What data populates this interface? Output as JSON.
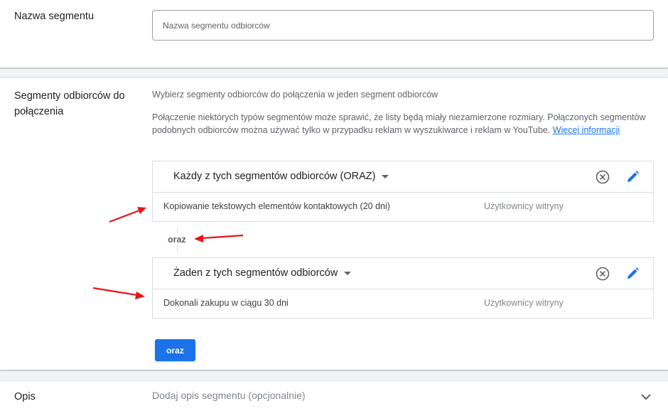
{
  "segment_name": {
    "label": "Nazwa segmentu",
    "placeholder": "Nazwa segmentu odbiorców",
    "value": ""
  },
  "segments_to_combine": {
    "label": "Segmenty odbiorców do połączenia",
    "intro": "Wybierz segmenty odbiorców do połączenia w jeden segment odbiorców",
    "info_text": "Połączenie niektórych typów segmentów może sprawić, że listy będą miały niezamierzone rozmiary. Połączonych segmentów podobnych odbiorców można używać tylko w przypadku reklam w wyszukiwarce i reklam w YouTube.",
    "info_link": "Więcej informacji",
    "groups": [
      {
        "title": "Każdy z tych segmentów odbiorców (ORAZ)",
        "rows": [
          {
            "name": "Kopiowanie tekstowych elementów kontaktowych (20 dni)",
            "type": "Użytkownicy witryny"
          }
        ]
      },
      {
        "title": "Żaden z tych segmentów odbiorców",
        "rows": [
          {
            "name": "Dokonali zakupu w ciągu 30 dni",
            "type": "Użytkownicy witryny"
          }
        ]
      }
    ],
    "connector": "oraz",
    "add_button": "oraz"
  },
  "description": {
    "label": "Opis",
    "placeholder": "Dodaj opis segmentu (opcjonalnie)"
  },
  "colors": {
    "accent": "#1a73e8",
    "annotation_arrow": "#e8141a",
    "separator_band": "#f1f3f4"
  },
  "icons": [
    "remove-circle-icon",
    "edit-pencil-icon",
    "caret-down-icon",
    "chevron-down-icon"
  ]
}
